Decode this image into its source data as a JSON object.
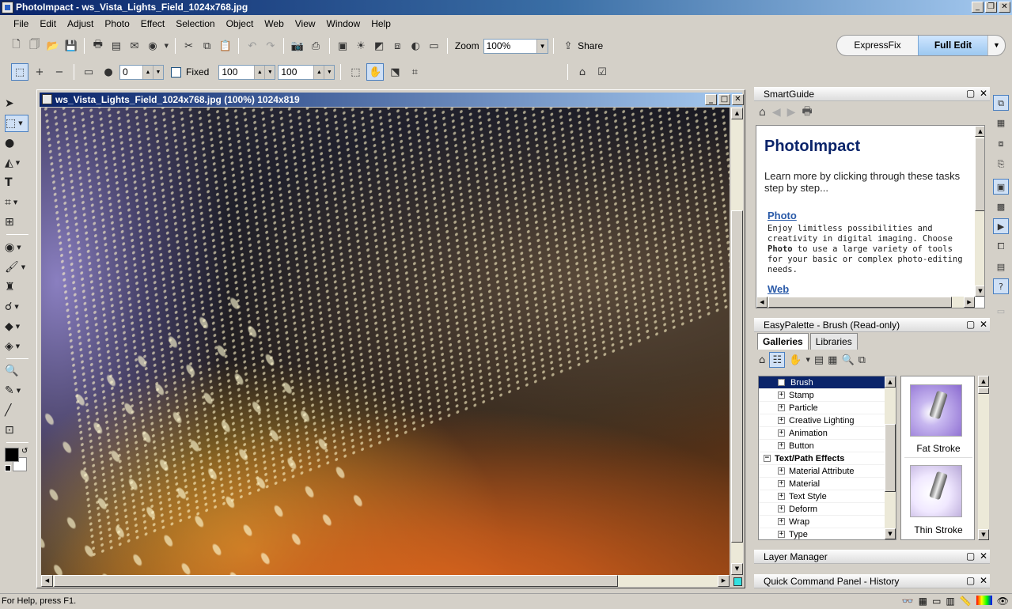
{
  "window": {
    "title": "PhotoImpact - ws_Vista_Lights_Field_1024x768.jpg"
  },
  "menu": [
    "File",
    "Edit",
    "Adjust",
    "Photo",
    "Effect",
    "Selection",
    "Object",
    "Web",
    "View",
    "Window",
    "Help"
  ],
  "toolbar": {
    "zoom_label": "Zoom",
    "zoom_value": "100%",
    "share_label": "Share"
  },
  "attribute_bar": {
    "spin_value": "0",
    "fixed_label": "Fixed",
    "width_value": "100",
    "height_value": "100"
  },
  "mode": {
    "express": "ExpressFix",
    "full": "Full Edit"
  },
  "document": {
    "title": "ws_Vista_Lights_Field_1024x768.jpg (100%) 1024x819"
  },
  "smartguide": {
    "title": "SmartGuide",
    "heading": "PhotoImpact",
    "intro": "Learn more by clicking through these tasks step by step...",
    "link_photo": "Photo",
    "desc_photo_1": "Enjoy limitless possibilities and creativity in digital imaging. Choose ",
    "desc_photo_bold": "Photo",
    "desc_photo_2": " to use a large variety of tools for your basic or complex photo-editing needs.",
    "link_web": "Web"
  },
  "easypalette": {
    "title": "EasyPalette - Brush (Read-only)",
    "tabs": [
      "Galleries",
      "Libraries"
    ],
    "tree": [
      {
        "label": "Brush",
        "level": 1,
        "selected": true,
        "sign": "+"
      },
      {
        "label": "Stamp",
        "level": 1,
        "sign": "+"
      },
      {
        "label": "Particle",
        "level": 1,
        "sign": "+"
      },
      {
        "label": "Creative Lighting",
        "level": 1,
        "sign": "+"
      },
      {
        "label": "Animation",
        "level": 1,
        "sign": "+"
      },
      {
        "label": "Button",
        "level": 1,
        "sign": "+"
      },
      {
        "label": "Text/Path Effects",
        "level": 0,
        "group": true,
        "sign": "−"
      },
      {
        "label": "Material Attribute",
        "level": 1,
        "sign": "+"
      },
      {
        "label": "Material",
        "level": 1,
        "sign": "+"
      },
      {
        "label": "Text Style",
        "level": 1,
        "sign": "+"
      },
      {
        "label": "Deform",
        "level": 1,
        "sign": "+"
      },
      {
        "label": "Wrap",
        "level": 1,
        "sign": "+"
      },
      {
        "label": "Type",
        "level": 1,
        "sign": "+"
      }
    ],
    "gallery": [
      {
        "label": "Fat Stroke"
      },
      {
        "label": "Thin Stroke"
      }
    ]
  },
  "layer_manager": {
    "title": "Layer Manager"
  },
  "quick_command": {
    "title": "Quick Command Panel - History"
  },
  "statusbar": {
    "text": "For Help, press F1."
  },
  "colors": {
    "titlebar_start": "#0a246a",
    "titlebar_end": "#a6caf0",
    "selection": "#0a246a",
    "link": "#2a5aa8"
  }
}
